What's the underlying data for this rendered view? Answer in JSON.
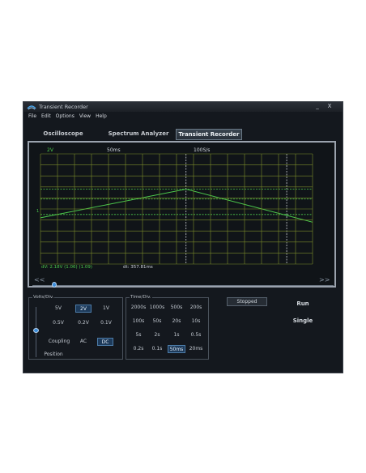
{
  "window": {
    "title": "Transient Recorder",
    "min_symbol": "_",
    "close_symbol": "X"
  },
  "menu": [
    "File",
    "Edit",
    "Options",
    "View",
    "Help"
  ],
  "tabs": [
    {
      "label": "Oscilloscope",
      "active": false
    },
    {
      "label": "Spectrum Analyzer",
      "active": false
    },
    {
      "label": "Transient Recorder",
      "active": true
    }
  ],
  "scope": {
    "volts_label": "2V",
    "time_label": "50ms",
    "rate_label": "100S/s",
    "ground_marker": "1",
    "dv_readout": "dV: 2.18V  (1.06)  (1.09)",
    "dt_readout": "dt: 357.81ms",
    "trace_color": "#4cc94c",
    "grid_color": "#7a8a2a",
    "cursor_color": "#4cc94c"
  },
  "scroll": {
    "left": "<<",
    "right": ">>"
  },
  "volts_panel": {
    "title": "Volts/Div.",
    "rows": [
      [
        "5V",
        "2V",
        "1V"
      ],
      [
        "0.5V",
        "0.2V",
        "0.1V"
      ]
    ],
    "selected": "2V",
    "coupling_label": "Coupling",
    "coupling_options": [
      "AC",
      "DC"
    ],
    "coupling_selected": "DC",
    "position_label": "Position"
  },
  "time_panel": {
    "title": "Time/Div.",
    "rows": [
      [
        "2000s",
        "1000s",
        "500s",
        "200s"
      ],
      [
        "100s",
        "50s",
        "20s",
        "10s"
      ],
      [
        "5s",
        "2s",
        "1s",
        "0.5s"
      ],
      [
        "0.2s",
        "0.1s",
        "50ms",
        "20ms"
      ]
    ],
    "selected": "50ms"
  },
  "controls": {
    "status": "Stopped",
    "run_label": "Run",
    "single_label": "Single"
  },
  "colors": {
    "accent": "#3c8cd8",
    "background": "#14181e"
  }
}
